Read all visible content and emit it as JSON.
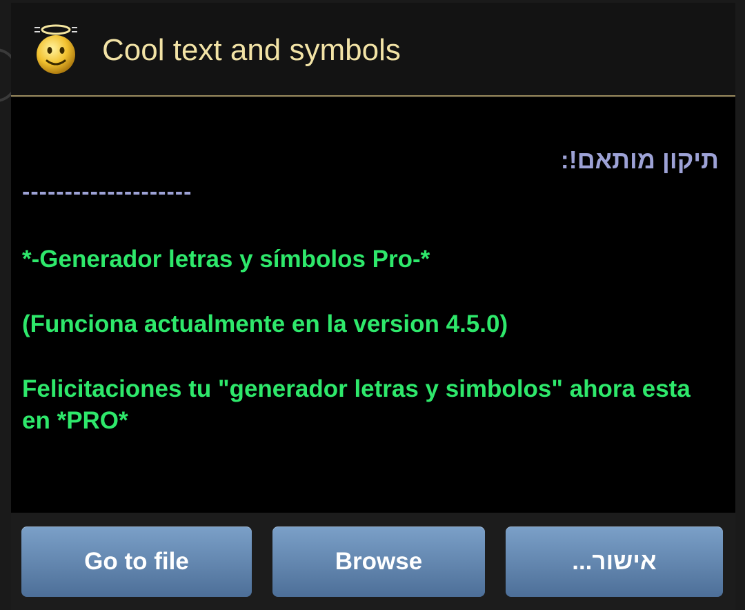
{
  "dialog": {
    "title": "Cool text and symbols",
    "icon": "angel-smiley-icon",
    "accent_color": "#f2e3a6"
  },
  "content": {
    "rtl_heading": "תיקון מותאם!:",
    "divider": "--------------------",
    "line1": "*-Generador letras y símbolos Pro-*",
    "line2": "(Funciona actualmente en la version 4.5.0)",
    "line3": "Felicitaciones tu \"generador letras y simbolos\" ahora esta en *PRO*",
    "text_color": "#2ee86b",
    "heading_color": "#9da2d6"
  },
  "buttons": {
    "goto_label": "Go to file",
    "browse_label": "Browse",
    "ok_label": "אישור..."
  }
}
